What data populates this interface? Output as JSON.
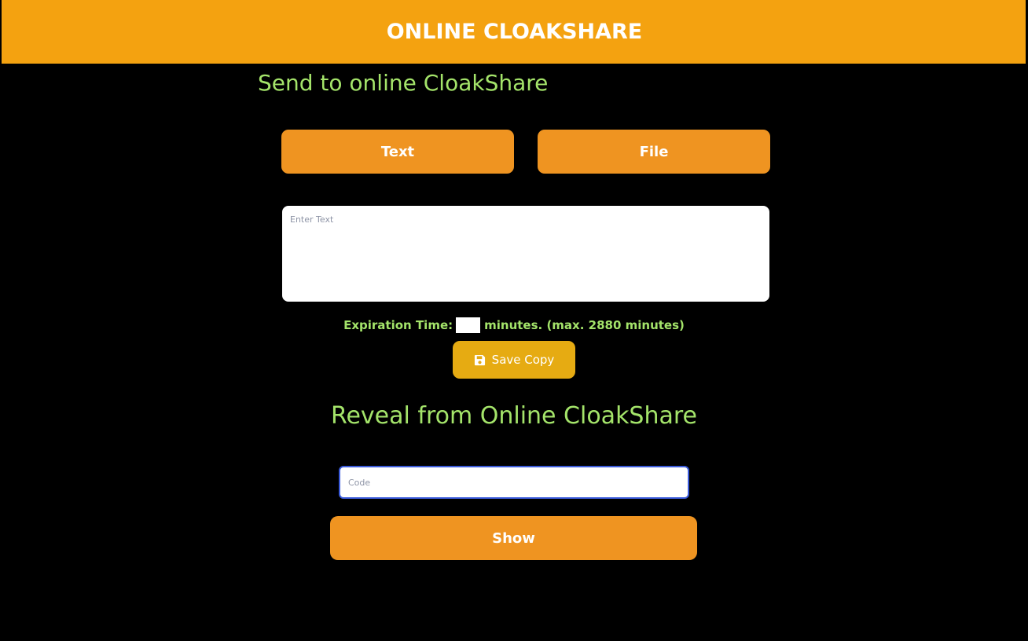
{
  "header": {
    "title": "ONLINE CLOAKSHARE"
  },
  "send": {
    "heading": "Send to online CloakShare",
    "tabs": [
      {
        "label": "Text"
      },
      {
        "label": "File"
      }
    ],
    "text_input": {
      "placeholder": "Enter Text",
      "value": ""
    },
    "expiration": {
      "label": "Expiration Time:",
      "value": "",
      "suffix": "minutes. (max. 2880 minutes)"
    },
    "save_button": {
      "label": "Save Copy",
      "icon": "floppy-disk-icon"
    }
  },
  "reveal": {
    "heading": "Reveal from Online CloakShare",
    "code_input": {
      "placeholder": "Code",
      "value": ""
    },
    "show_button": {
      "label": "Show"
    }
  },
  "colors": {
    "header_bg": "#f4a210",
    "button_bg": "#ef9421",
    "save_button_bg": "#e6ab12",
    "heading_text": "#a4e46a",
    "page_bg": "#000000",
    "code_input_border": "#3b5bdb"
  }
}
